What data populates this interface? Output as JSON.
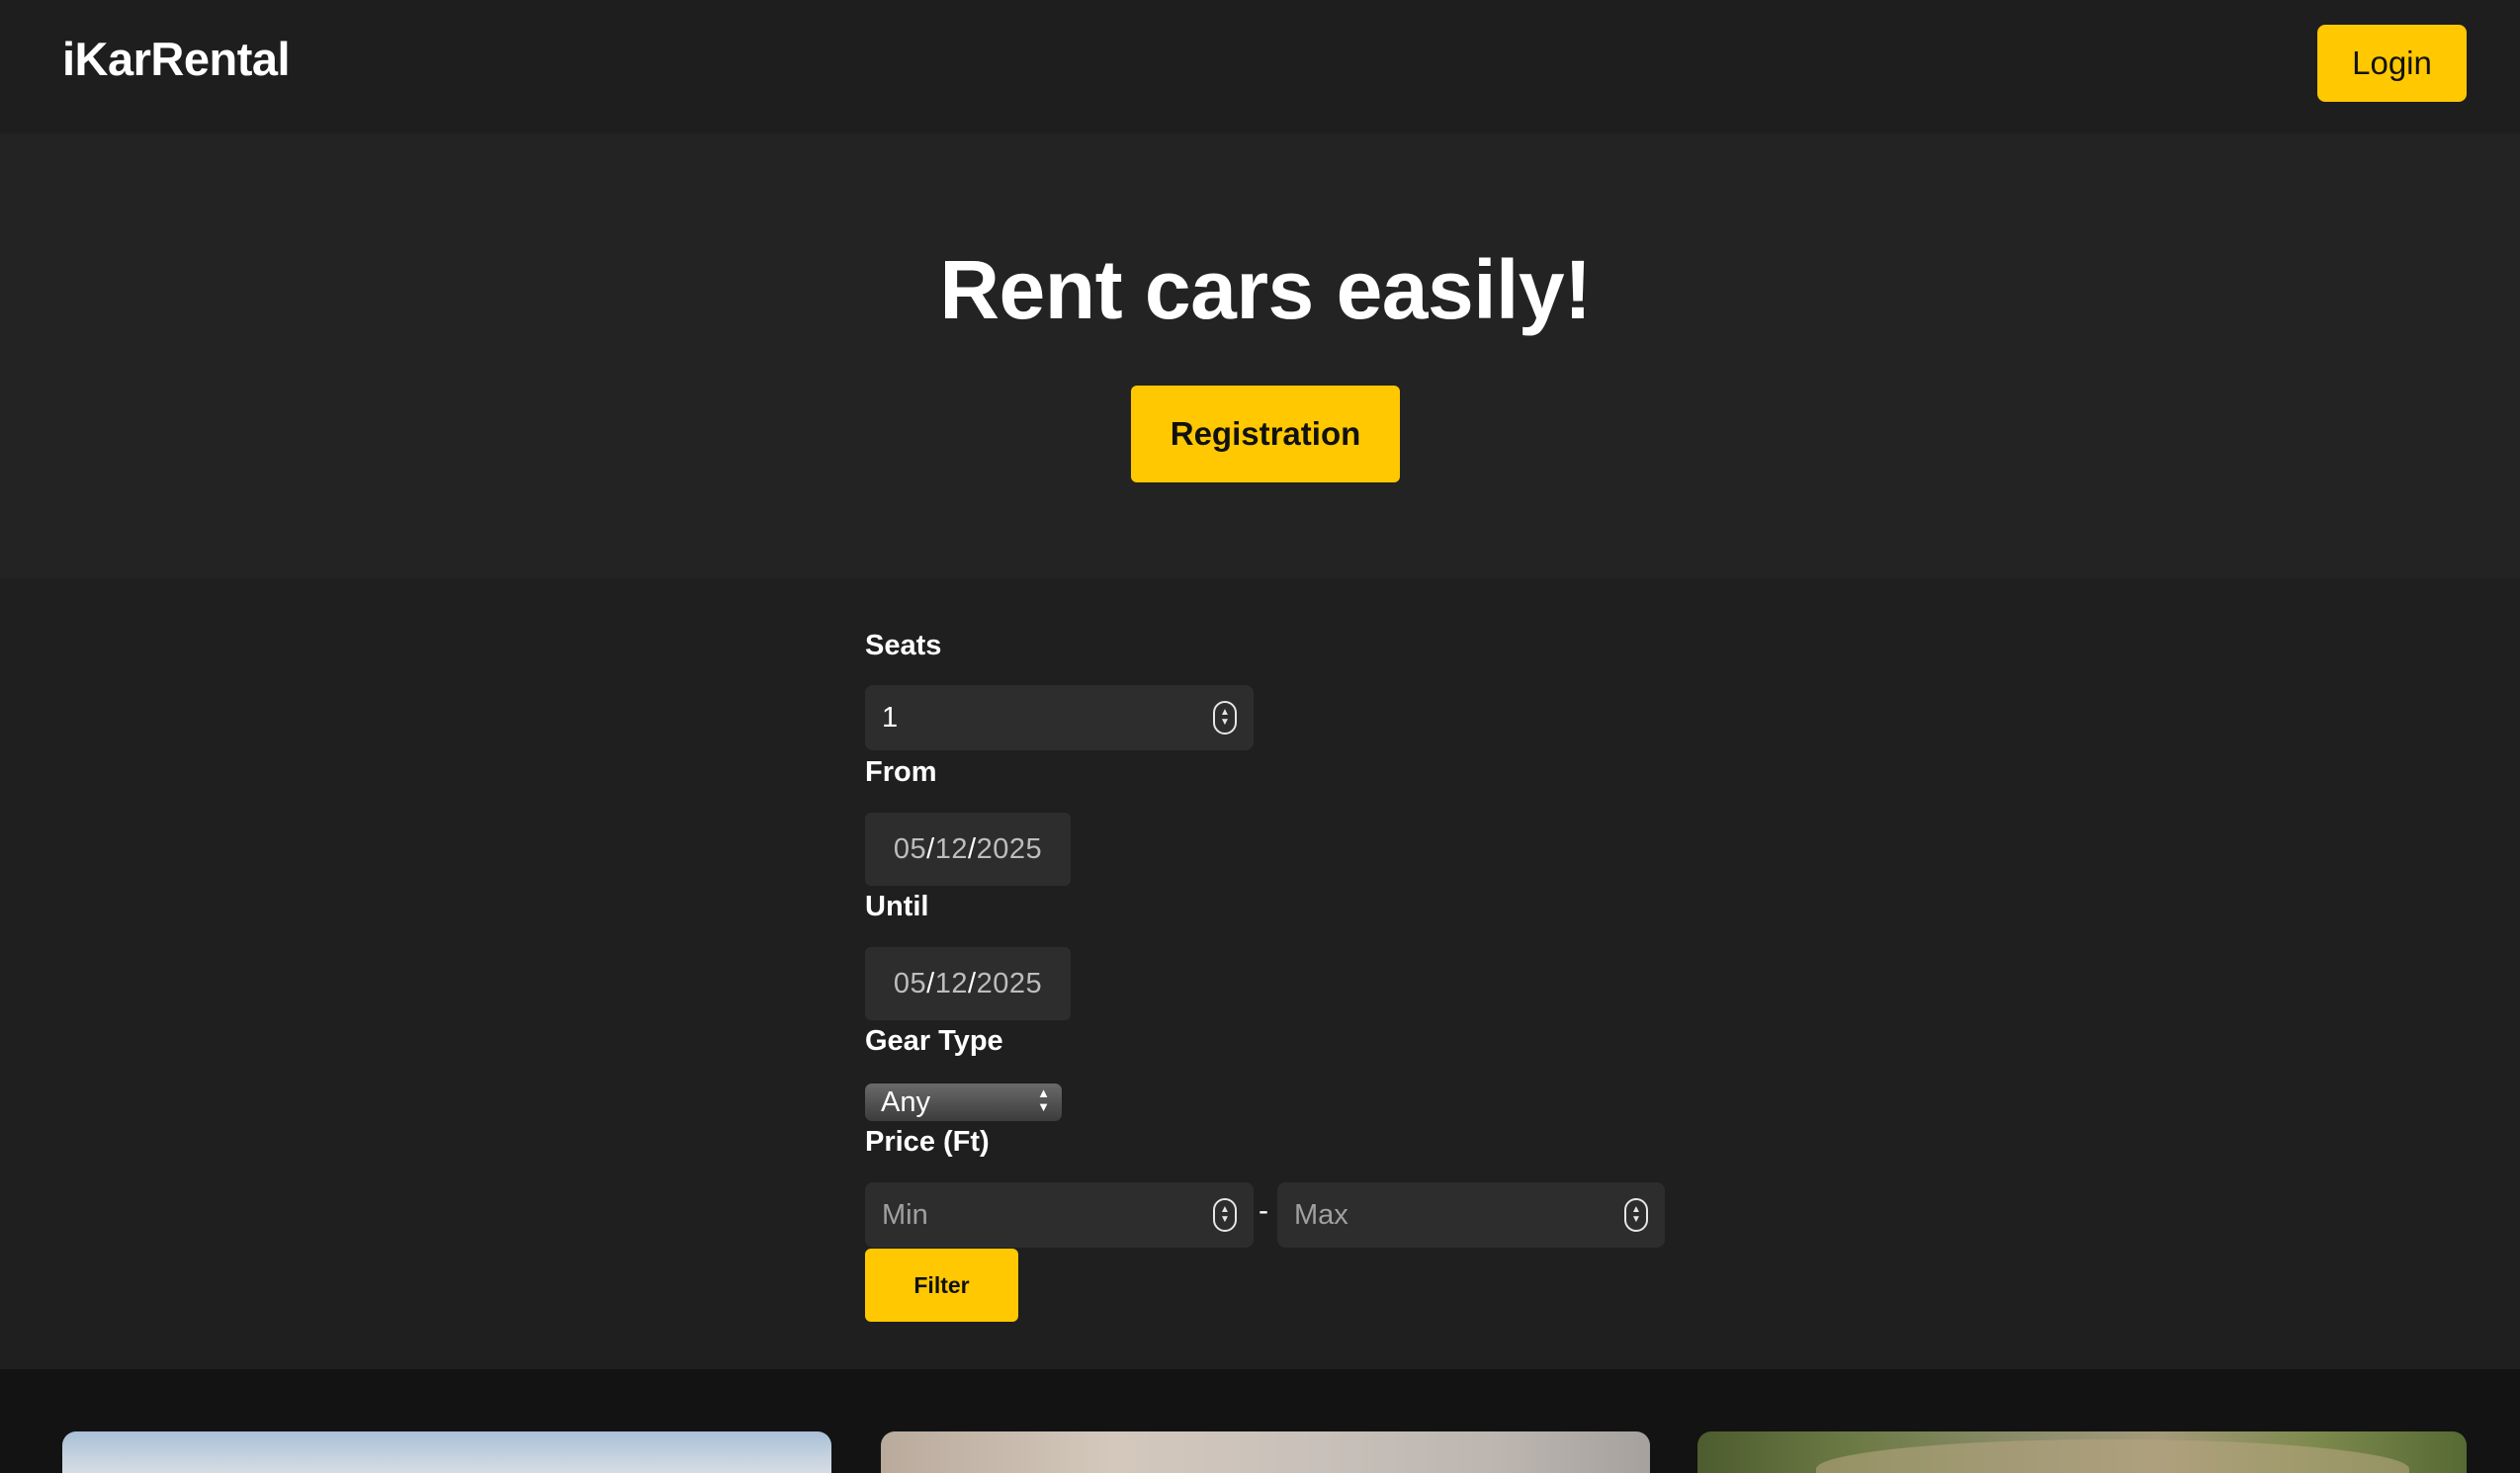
{
  "header": {
    "brand": "iKarRental",
    "login_label": "Login"
  },
  "hero": {
    "title": "Rent cars easily!",
    "registration_label": "Registration"
  },
  "filters": {
    "seats_label": "Seats",
    "seats_value": "1",
    "from_label": "From",
    "from_date": {
      "month": "05",
      "day": "12",
      "year": "2025"
    },
    "until_label": "Until",
    "until_date": {
      "month": "05",
      "day": "12",
      "year": "2025"
    },
    "gear_label": "Gear Type",
    "gear_value": "Any",
    "price_label": "Price (Ft)",
    "price_min_placeholder": "Min",
    "price_max_placeholder": "Max",
    "price_separator": "-",
    "filter_label": "Filter"
  },
  "colors": {
    "accent": "#ffc800",
    "background": "#232323",
    "header": "#1e1e1e",
    "field": "#2d2d2d"
  }
}
